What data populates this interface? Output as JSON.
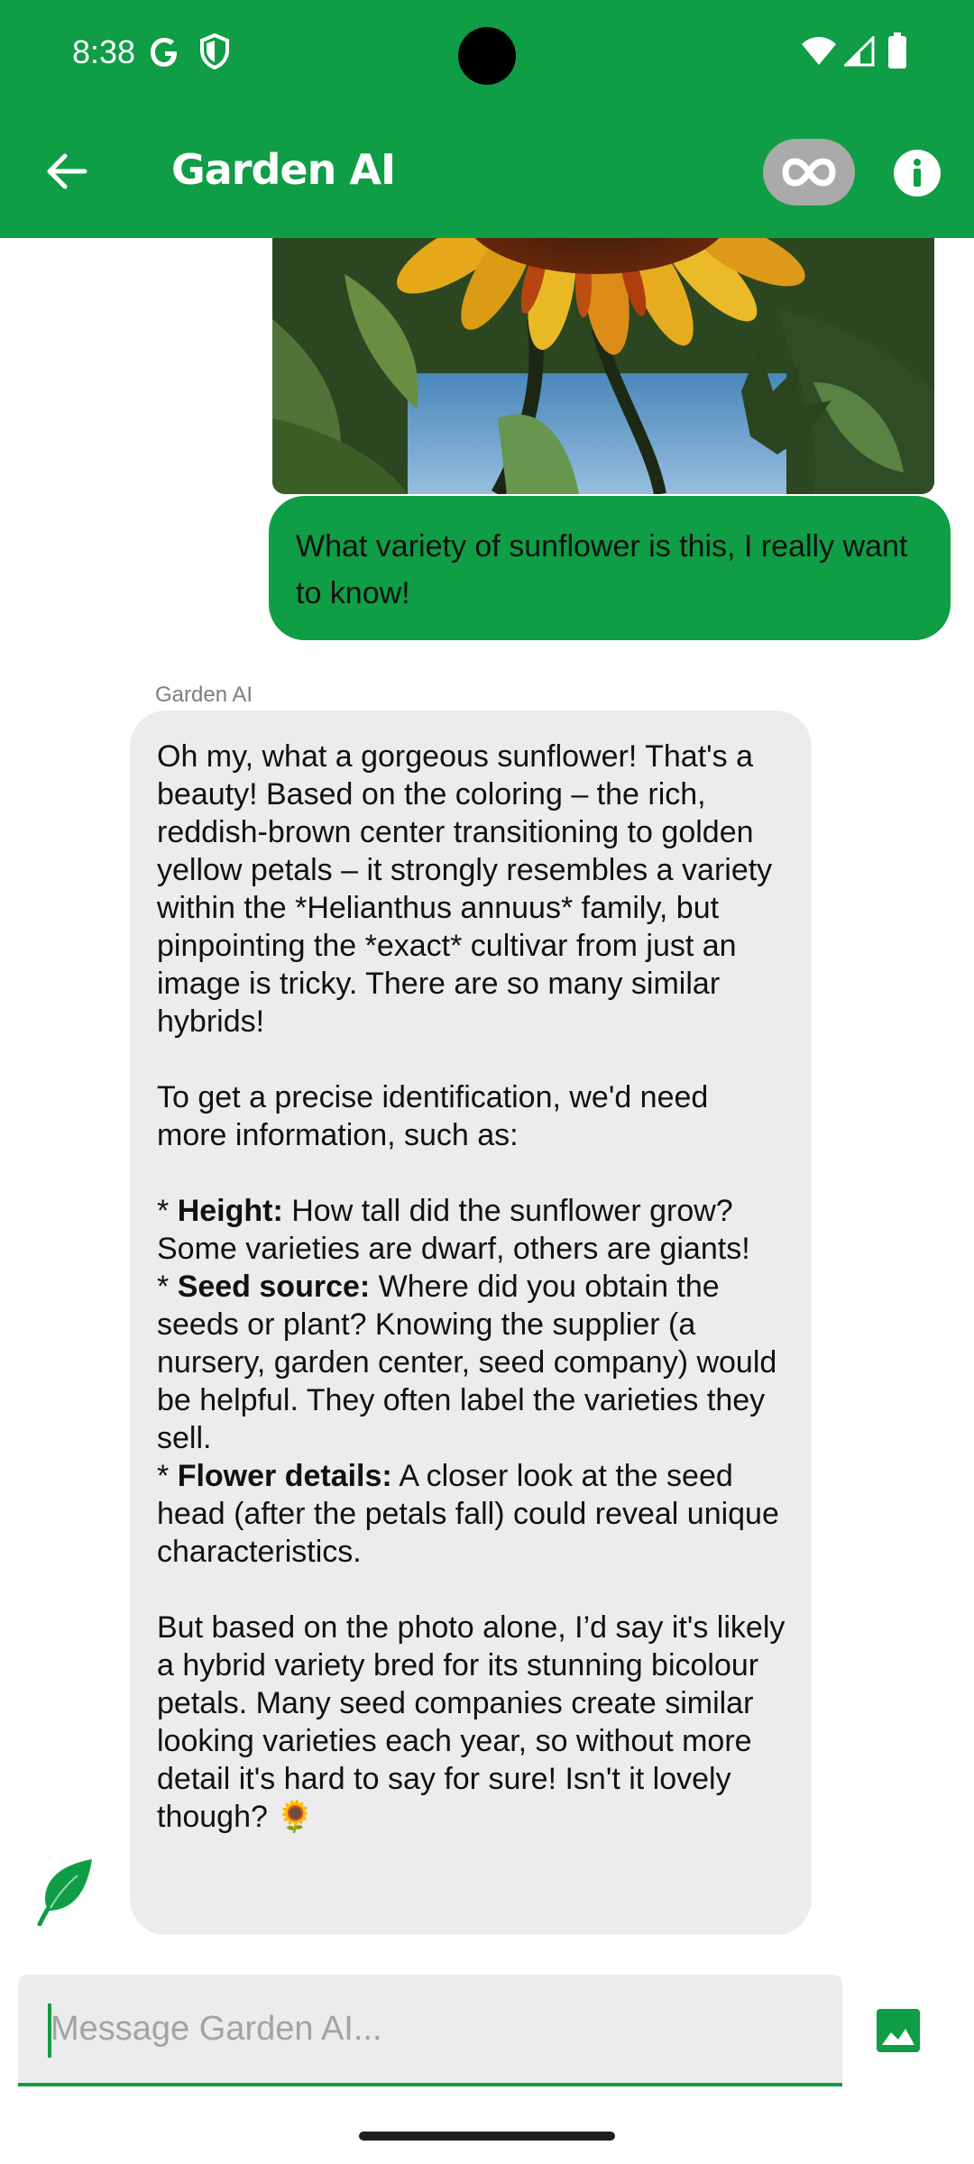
{
  "status_bar": {
    "time": "8:38"
  },
  "app_bar": {
    "title": "Garden AI",
    "infinity_symbol": "∞",
    "icons": [
      "back-arrow-icon",
      "infinity-icon",
      "info-icon"
    ]
  },
  "colors": {
    "brand_green": "#0f9d45",
    "bubble_gray": "#ececec",
    "pill_gray": "#a9aaa9"
  },
  "messages": {
    "user": {
      "text": "What variety of sunflower is this, I really want to know!"
    },
    "ai": {
      "sender": "Garden AI",
      "intro": "Oh my, what a gorgeous sunflower!  That's a beauty!  Based on the coloring – the rich, reddish-brown center transitioning to golden yellow petals – it strongly resembles a variety within the *Helianthus annuus* family, but pinpointing the *exact* cultivar from just an image is tricky.  There are so many similar hybrids!",
      "request": "To get a precise identification, we'd need more information, such as:",
      "bullets": [
        {
          "prefix": "* ",
          "label": "Height:",
          "text": " How tall did the sunflower grow?  Some varieties are dwarf, others are giants!"
        },
        {
          "prefix": "* ",
          "label": "Seed source:",
          "text": " Where did you obtain the seeds or plant? Knowing the supplier (a nursery, garden center, seed company) would be helpful.  They often label the varieties they sell."
        },
        {
          "prefix": "* ",
          "label": "Flower details:",
          "text": "  A closer look at the seed head (after the petals fall) could reveal unique characteristics."
        }
      ],
      "conclusion": "But based on the photo alone, I’d say it's likely a hybrid variety bred for its stunning bicolour petals.  Many seed companies create similar looking varieties each year, so without more detail it's hard to say for sure!  Isn't it lovely though?  🌻"
    }
  },
  "composer": {
    "placeholder": "Message Garden AI...",
    "value": ""
  }
}
